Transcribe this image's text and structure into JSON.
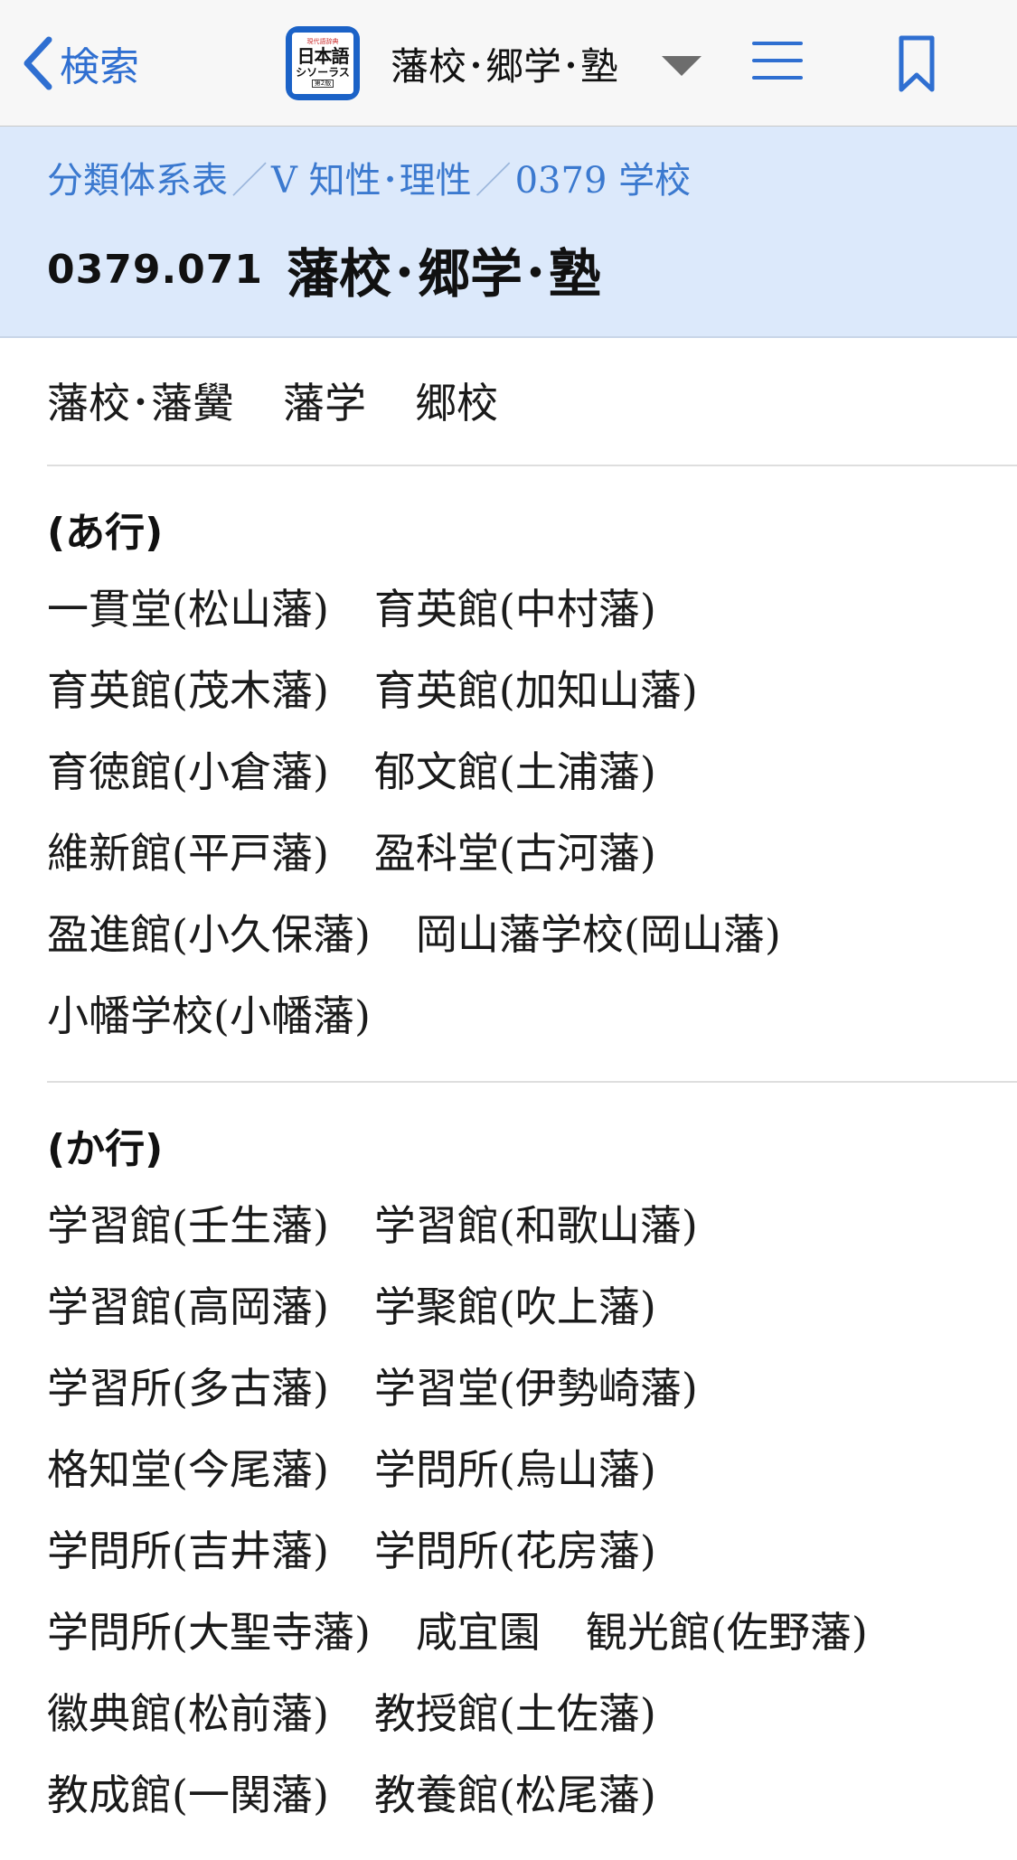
{
  "nav": {
    "back_label": "検索",
    "app_icon": {
      "line1": "現代語辞典",
      "line2": "日本語",
      "line3": "シソーラス",
      "line4": "第2版"
    },
    "title": "藩校･郷学･塾",
    "icons": [
      "chevron-left-icon",
      "caret-down-icon",
      "menu-icon",
      "bookmark-icon"
    ],
    "accent_color": "#2f6fd1"
  },
  "header": {
    "breadcrumb": [
      "分類体系表",
      "V 知性･理性",
      "0379 学校"
    ],
    "breadcrumb_separator": "／",
    "code": "0379.071",
    "title": "藩校･郷学･塾",
    "background_color": "#dce9fb"
  },
  "keywords": [
    "藩校･藩黌",
    "藩学",
    "郷校"
  ],
  "sections": [
    {
      "heading": "(あ行)",
      "lines": [
        [
          "一貫堂(松山藩)",
          "育英館(中村藩)"
        ],
        [
          "育英館(茂木藩)",
          "育英館(加知山藩)"
        ],
        [
          "育徳館(小倉藩)",
          "郁文館(土浦藩)"
        ],
        [
          "維新館(平戸藩)",
          "盈科堂(古河藩)"
        ],
        [
          "盈進館(小久保藩)",
          "岡山藩学校(岡山藩)"
        ],
        [
          "小幡学校(小幡藩)"
        ]
      ]
    },
    {
      "heading": "(か行)",
      "lines": [
        [
          "学習館(壬生藩)",
          "学習館(和歌山藩)"
        ],
        [
          "学習館(高岡藩)",
          "学聚館(吹上藩)"
        ],
        [
          "学習所(多古藩)",
          "学習堂(伊勢崎藩)"
        ],
        [
          "格知堂(今尾藩)",
          "学問所(烏山藩)"
        ],
        [
          "学問所(吉井藩)",
          "学問所(花房藩)"
        ],
        [
          "学問所(大聖寺藩)",
          "咸宜園",
          "観光館(佐野藩)"
        ],
        [
          "徽典館(松前藩)",
          "教授館(土佐藩)"
        ],
        [
          "教成館(一関藩)",
          "教養館(松尾藩)"
        ]
      ]
    }
  ]
}
